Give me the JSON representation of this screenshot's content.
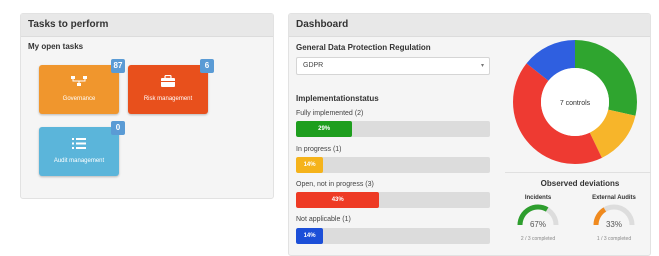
{
  "tasks": {
    "title": "Tasks to perform",
    "section": "My open tasks",
    "tiles": [
      {
        "label": "Governance",
        "icon": "org-chart-icon",
        "badge": "87",
        "color": "#f0962d"
      },
      {
        "label": "Risk management",
        "icon": "briefcase-icon",
        "badge": "6",
        "color": "#e8501c"
      },
      {
        "label": "Audit management",
        "icon": "list-icon",
        "badge": "0",
        "color": "#5bb5da"
      }
    ]
  },
  "dashboard": {
    "title": "Dashboard",
    "regulation_label": "General Data Protection Regulation",
    "regulation_value": "GDPR",
    "impl_title": "Implementationstatus",
    "statuses": [
      {
        "label": "Fully implemented (2)",
        "percent_label": "29%",
        "percent": 29,
        "color": "#1e9e1e"
      },
      {
        "label": "In progress (1)",
        "percent_label": "14%",
        "percent": 14,
        "color": "#f5b31b"
      },
      {
        "label": "Open, not in progress (3)",
        "percent_label": "43%",
        "percent": 43,
        "color": "#ee3a24"
      },
      {
        "label": "Not applicable (1)",
        "percent_label": "14%",
        "percent": 14,
        "color": "#1c4fd8"
      }
    ],
    "donut": {
      "center_label": "7 controls",
      "segments": [
        {
          "name": "Fully implemented",
          "value": 2,
          "color": "#2fa52f"
        },
        {
          "name": "In progress",
          "value": 1,
          "color": "#f7b52a"
        },
        {
          "name": "Open, not in progress",
          "value": 3,
          "color": "#ee3a32"
        },
        {
          "name": "Not applicable",
          "value": 1,
          "color": "#2f5fe0"
        }
      ]
    },
    "deviations": {
      "title": "Observed deviations",
      "gauges": [
        {
          "title": "Incidents",
          "value_label": "67%",
          "value": 0.67,
          "sub": "2 / 3 completed",
          "color": "#2e9e2e"
        },
        {
          "title": "External Audits",
          "value_label": "33%",
          "value": 0.33,
          "sub": "1 / 3 completed",
          "color": "#f08a1e"
        }
      ]
    }
  }
}
